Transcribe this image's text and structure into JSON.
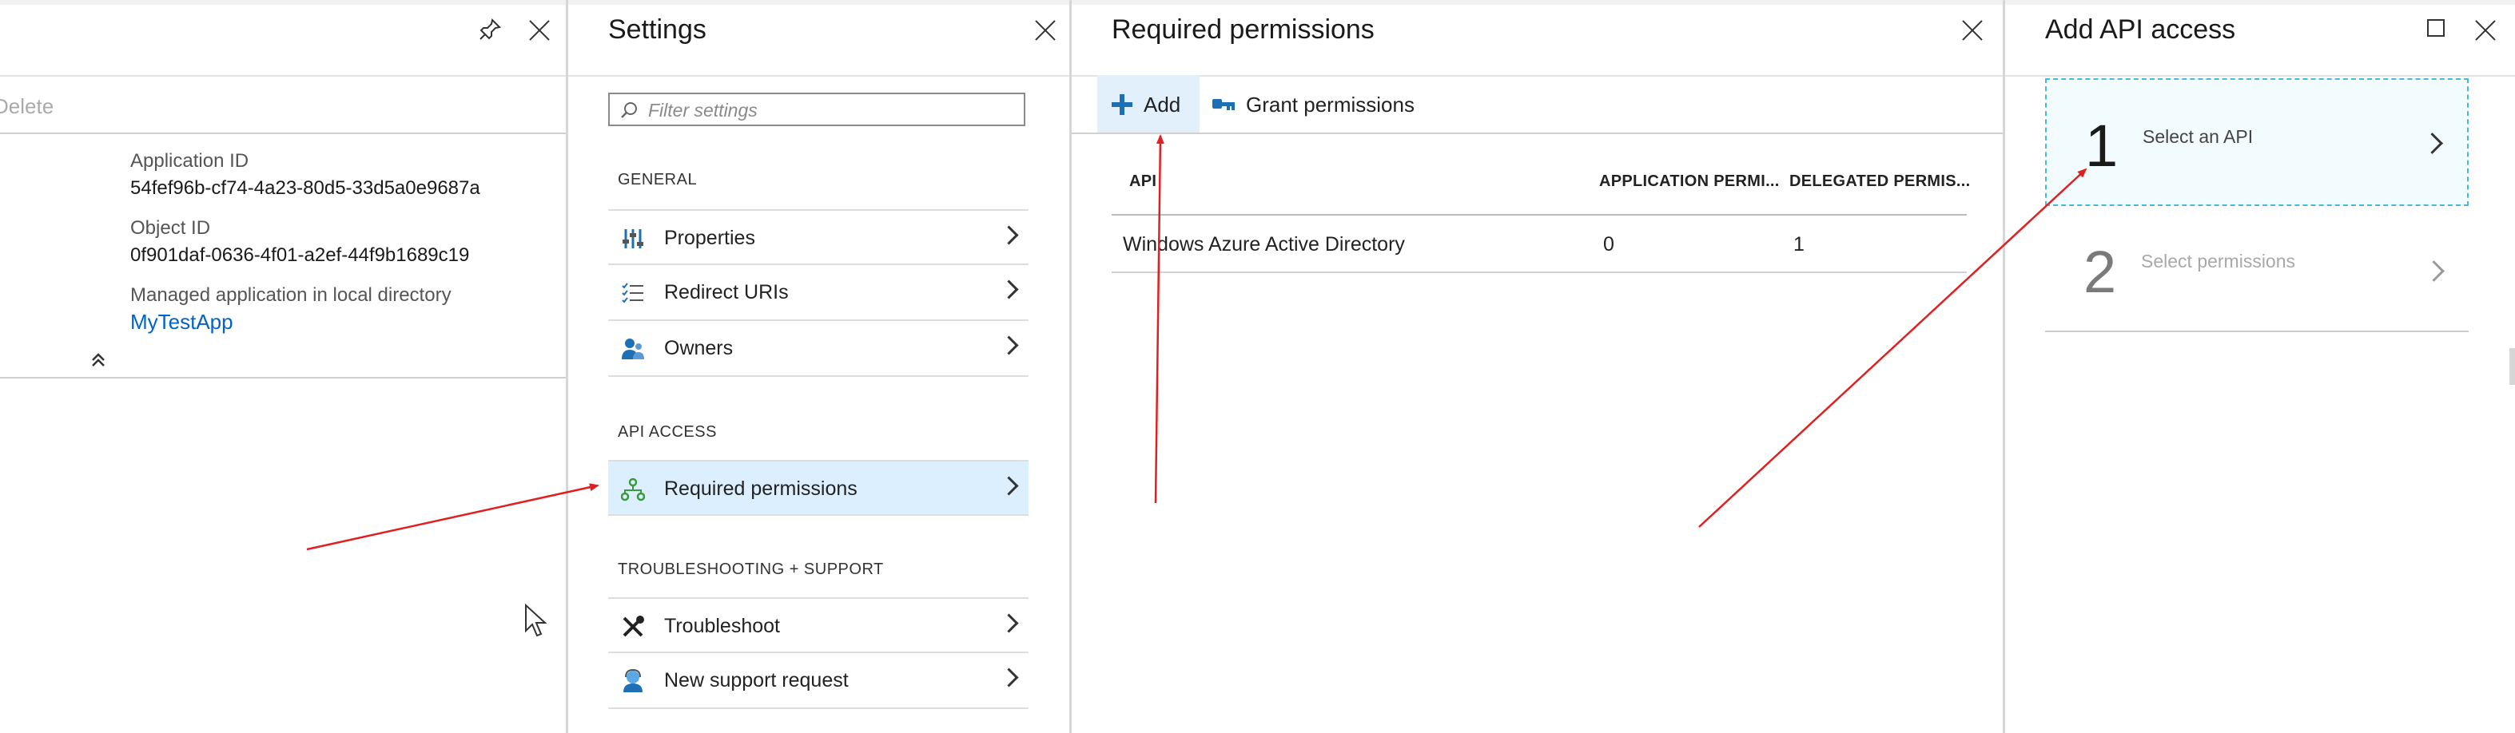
{
  "blade_app": {
    "delete_label": "Delete",
    "fields": [
      {
        "label": "Application ID",
        "value": "54fef96b-cf74-4a23-80d5-33d5a0e9687a"
      },
      {
        "label": "Object ID",
        "value": "0f901daf-0636-4f01-a2ef-44f9b1689c19"
      },
      {
        "label": "Managed application in local directory",
        "value": "MyTestApp"
      }
    ]
  },
  "settings": {
    "title": "Settings",
    "filter_placeholder": "Filter settings",
    "sections": [
      {
        "header": "GENERAL",
        "items": [
          {
            "label": "Properties",
            "icon": "sliders-icon"
          },
          {
            "label": "Redirect URIs",
            "icon": "checklist-icon"
          },
          {
            "label": "Owners",
            "icon": "users-icon"
          }
        ]
      },
      {
        "header": "API ACCESS",
        "items": [
          {
            "label": "Required permissions",
            "icon": "hierarchy-icon",
            "active": true
          }
        ]
      },
      {
        "header": "TROUBLESHOOTING + SUPPORT",
        "items": [
          {
            "label": "Troubleshoot",
            "icon": "tools-icon"
          },
          {
            "label": "New support request",
            "icon": "support-person-icon"
          }
        ]
      }
    ]
  },
  "required_permissions": {
    "title": "Required permissions",
    "toolbar": {
      "add_label": "Add",
      "grant_label": "Grant permissions"
    },
    "columns": [
      "API",
      "APPLICATION PERMI...",
      "DELEGATED PERMIS..."
    ],
    "rows": [
      {
        "api": "Windows Azure Active Directory",
        "app_perms": "0",
        "delegated_perms": "1"
      }
    ]
  },
  "add_api_access": {
    "title": "Add API access",
    "steps": [
      {
        "number": "1",
        "label": "Select an API",
        "state": "active"
      },
      {
        "number": "2",
        "label": "Select permissions",
        "state": "disabled"
      }
    ]
  },
  "colors": {
    "accent": "#0063c7",
    "active_bg": "#dcefff",
    "annotation_arrow": "#e02020",
    "step_border": "#49b8d6"
  }
}
